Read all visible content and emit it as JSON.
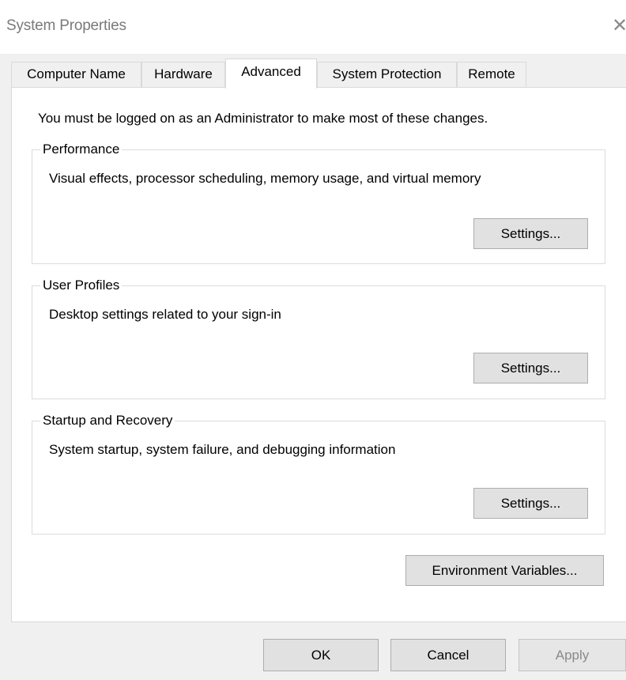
{
  "window": {
    "title": "System Properties",
    "close_glyph": "✕"
  },
  "tabs": [
    {
      "label": "Computer Name",
      "selected": false
    },
    {
      "label": "Hardware",
      "selected": false
    },
    {
      "label": "Advanced",
      "selected": true
    },
    {
      "label": "System Protection",
      "selected": false
    },
    {
      "label": "Remote",
      "selected": false
    }
  ],
  "advanced": {
    "admin_note": "You must be logged on as an Administrator to make most of these changes.",
    "performance": {
      "legend": "Performance",
      "description": "Visual effects, processor scheduling, memory usage, and virtual memory",
      "button": "Settings..."
    },
    "user_profiles": {
      "legend": "User Profiles",
      "description": "Desktop settings related to your sign-in",
      "button": "Settings..."
    },
    "startup_recovery": {
      "legend": "Startup and Recovery",
      "description": "System startup, system failure, and debugging information",
      "button": "Settings..."
    },
    "env_vars_button": "Environment Variables..."
  },
  "footer": {
    "ok": "OK",
    "cancel": "Cancel",
    "apply": "Apply",
    "apply_enabled": false
  },
  "colors": {
    "dialog_bg": "#f0f0f0",
    "panel_bg": "#ffffff",
    "button_bg": "#e1e1e1",
    "button_border": "#adadad",
    "disabled_text": "#8a8a8a",
    "title_text": "#7a7a7a"
  }
}
